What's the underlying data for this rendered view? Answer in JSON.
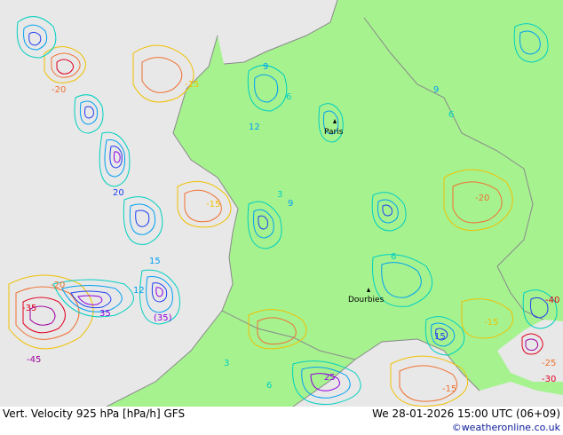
{
  "map": {
    "colors": {
      "land": "#a6f28f",
      "sea": "#e8e8e8",
      "border": "#8a8a8a",
      "negative_low": "#f0c000",
      "negative_mid": "#f07030",
      "negative_high": "#e00020",
      "negative_extreme": "#a000a0",
      "positive_low": "#00d0c0",
      "positive_mid": "#00a0f0",
      "positive_high": "#2040f0",
      "positive_extreme": "#9000e0"
    },
    "cities": [
      {
        "name": "Paris"
      },
      {
        "name": "Dourbies"
      }
    ],
    "contour_labels": {
      "neg15": "-15",
      "neg20": "-20",
      "neg25": "-25",
      "neg30": "-30",
      "neg35": "-35",
      "neg40": "-40",
      "neg45": "-45",
      "pos3": "3",
      "pos6": "6",
      "pos9": "9",
      "pos12": "12",
      "pos15": "15",
      "pos20": "20",
      "pos25": "25",
      "pos35": "35",
      "bracket35": "(35)"
    }
  },
  "footer": {
    "title": "Vert. Velocity 925 hPa [hPa/h] GFS",
    "timestamp": "We 28-01-2026 15:00 UTC (06+09)",
    "credit": "©weatheronline.co.uk"
  }
}
